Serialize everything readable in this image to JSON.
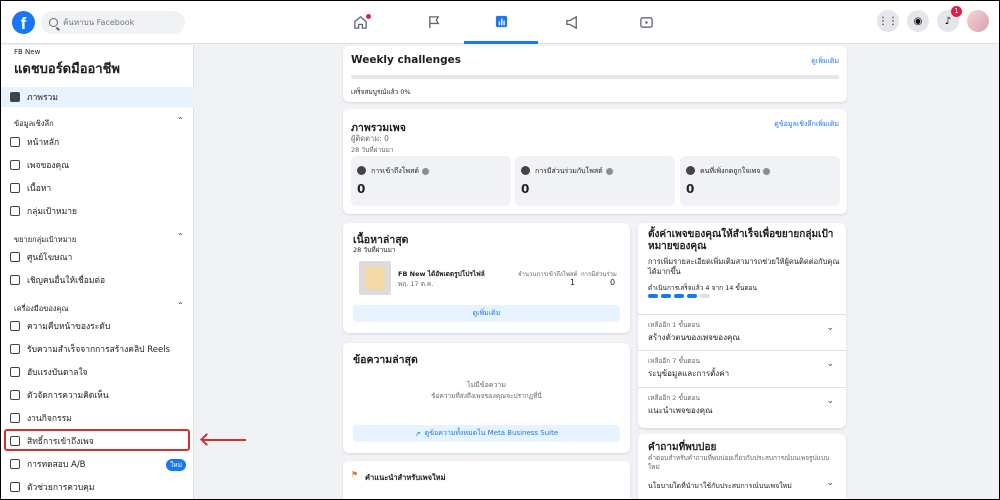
{
  "topbar": {
    "logo": "f",
    "search_placeholder": "ค้นหาบน Facebook",
    "notification_count": "1"
  },
  "sidebar": {
    "page_name": "FB New",
    "title": "แดชบอร์ดมืออาชีพ",
    "overview": "ภาพรวม",
    "section_insights": "ข้อมูลเชิงลึก",
    "insights_items": [
      "หน้าหลัก",
      "เพจของคุณ",
      "เนื้อหา",
      "กลุ่มเป้าหมาย"
    ],
    "section_grow": "ขยายกลุ่มเป้าหมาย",
    "grow_items": [
      "ศูนย์โฆษณา",
      "เชิญคนอื่นให้เชื่อมต่อ"
    ],
    "section_tools": "เครื่องมือของคุณ",
    "tools_items": [
      "ความคืบหน้าของระดับ",
      "รับความสำเร็จจากการสร้างคลิป Reels",
      "ฮับแรงบันดาลใจ",
      "ตัวจัดการความคิดเห็น",
      "งานกิจกรรม",
      "สิทธิ์การเข้าถึงเพจ",
      "การทดสอบ A/B",
      "ตัวช่วยการควบคุม"
    ],
    "new_badge": "ใหม่"
  },
  "weekly": {
    "title": "Weekly challenges",
    "link": "ดูเพิ่มเติม",
    "status": "เสร็จสมบูรณ์แล้ว 0%"
  },
  "overview_card": {
    "title": "ภาพรวมเพจ",
    "link": "ดูข้อมูลเชิงลึกเพิ่มเติม",
    "followers": "ผู้ติดตาม: 0",
    "period": "28 วันที่ผ่านมา",
    "stats": [
      {
        "label": "การเข้าถึงโพสต์",
        "value": "0"
      },
      {
        "label": "การมีส่วนร่วมกับโพสต์",
        "value": "0"
      },
      {
        "label": "คนที่เพิ่งกดถูกใจเพจ",
        "value": "0"
      }
    ]
  },
  "latest_content": {
    "title": "เนื้อหาล่าสุด",
    "period": "28 วันที่ผ่านมา",
    "post_title": "FB New ได้อัพเดตรูปโปรไฟล์",
    "post_date": "พฤ. 17 ต.ค.",
    "col1": "จำนวนการเข้าถึงโพสต์",
    "col2": "การมีส่วนร่วม",
    "val1": "1",
    "val2": "0",
    "button": "ดูเพิ่มเติม"
  },
  "messages": {
    "title": "ข้อความล่าสุด",
    "empty": "ไม่มีข้อความ",
    "empty_desc": "ข้อความที่ส่งถึงเพจของคุณจะปรากฏที่นี่",
    "button": "ดูข้อความทั้งหมดใน Meta Business Suite"
  },
  "suggestions": {
    "title": "คำแนะนำสำหรับเพจใหม่"
  },
  "setup": {
    "title": "ตั้งค่าเพจของคุณให้สำเร็จเพื่อขยายกลุ่มเป้าหมายของคุณ",
    "desc": "การเพิ่มรายละเอียดเพิ่มเติมสามารถช่วยให้ผู้คนติดต่อกับคุณได้มากขึ้น",
    "progress": "ดำเนินการเสร็จแล้ว 4 จาก 14 ขั้นตอน",
    "steps_done": 4,
    "steps_total": 14,
    "items": [
      {
        "sub": "เหลืออีก 1 ขั้นตอน",
        "title": "สร้างตัวตนของเพจของคุณ"
      },
      {
        "sub": "เหลืออีก 7 ขั้นตอน",
        "title": "ระบุข้อมูลและการตั้งค่า"
      },
      {
        "sub": "เหลืออีก 2 ขั้นตอน",
        "title": "แนะนำเพจของคุณ"
      }
    ]
  },
  "faq": {
    "title": "คำถามที่พบบ่อย",
    "desc": "คำตอบสำหรับคำถามที่พบบ่อยเกี่ยวกับประสบการณ์บนเพจรูปแบบใหม่",
    "item": "นโยบายใดที่นำมาใช้กับประสบการณ์บนเพจใหม่"
  },
  "colors": {
    "brand": "#1877f2",
    "highlight": "#d32f2f"
  }
}
